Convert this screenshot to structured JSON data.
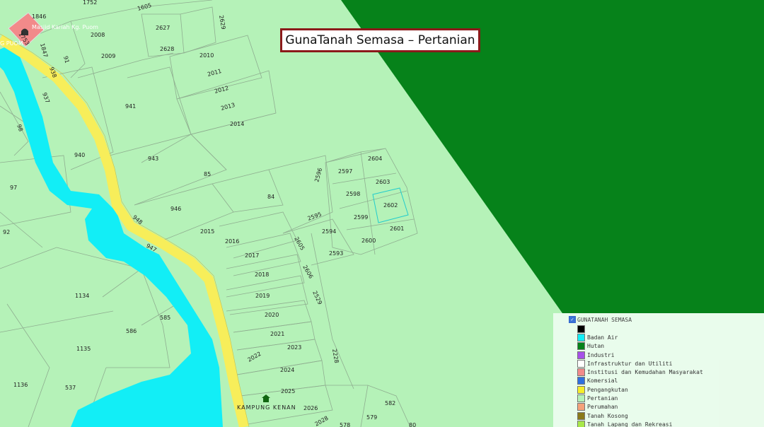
{
  "map": {
    "title": "GunaTanah Semasa – Pertanian",
    "colors": {
      "background": "#b5f2b8",
      "forest": "#06821a",
      "river": "#12eef6",
      "road": "#f7ee5a",
      "institution": "#f28a8a",
      "parcel_line": "#8fae90"
    },
    "places": {
      "mosque": "Masjid Kariah Kg. Puom",
      "kampung_puom": "G PUOM",
      "kampung_kenan": "KAMPUNG KENAN"
    },
    "lots": [
      "1752",
      "1605",
      "1846",
      "1753",
      "1847",
      "2008",
      "2627",
      "2629",
      "2009",
      "2628",
      "2010",
      "2011",
      "2012",
      "2013",
      "2014",
      "91",
      "938",
      "937",
      "941",
      "98",
      "940",
      "943",
      "85",
      "97",
      "2604",
      "2597",
      "2603",
      "2596",
      "2598",
      "84",
      "946",
      "2602",
      "2595",
      "2599",
      "2601",
      "948",
      "92",
      "2015",
      "2594",
      "2016",
      "2605",
      "2600",
      "947",
      "2017",
      "2593",
      "2018",
      "2606",
      "2019",
      "2529",
      "1134",
      "585",
      "2020",
      "586",
      "2021",
      "2023",
      "1135",
      "2022",
      "2228",
      "2024",
      "1136",
      "537",
      "2025",
      "2026",
      "582",
      "579",
      "2028",
      "578",
      "80"
    ]
  },
  "legend": {
    "checked": true,
    "title": "GUNATANAH SEMASA",
    "items": [
      {
        "label": "",
        "color": "#000000"
      },
      {
        "label": "Badan Air",
        "color": "#12eef6"
      },
      {
        "label": "Hutan",
        "color": "#06821a"
      },
      {
        "label": "Industri",
        "color": "#a650e8"
      },
      {
        "label": "Infrastruktur dan Utiliti",
        "color": "#ffffff"
      },
      {
        "label": "Institusi dan Kemudahan Masyarakat",
        "color": "#f28a8a"
      },
      {
        "label": "Komersial",
        "color": "#2f6fe0"
      },
      {
        "label": "Pengangkutan",
        "color": "#f7ee2a"
      },
      {
        "label": "Pertanian",
        "color": "#b5f2b8"
      },
      {
        "label": "Perumahan",
        "color": "#f5a27a"
      },
      {
        "label": "Tanah Kosong",
        "color": "#8a7a1a"
      },
      {
        "label": "Tanah Lapang dan Rekreasi",
        "color": "#a8e84a"
      }
    ]
  }
}
